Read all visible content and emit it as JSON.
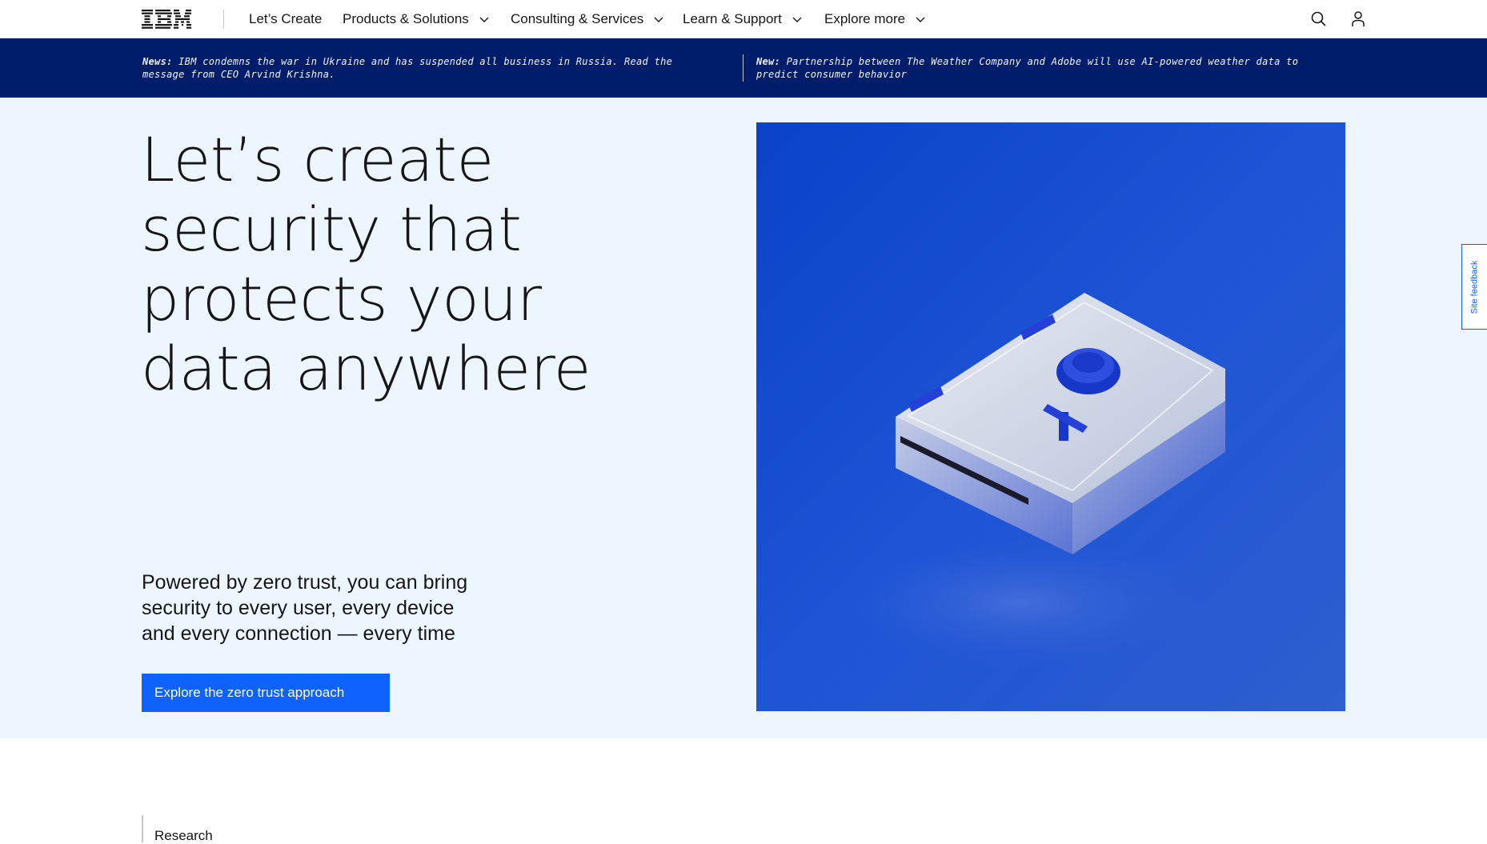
{
  "nav": {
    "logo_text": "IBM",
    "items": [
      {
        "label": "Let’s Create",
        "has_dropdown": false
      },
      {
        "label": "Products & Solutions",
        "has_dropdown": true
      },
      {
        "label": "Consulting & Services",
        "has_dropdown": true
      },
      {
        "label": "Learn & Support",
        "has_dropdown": true
      },
      {
        "label": "Explore more",
        "has_dropdown": true
      }
    ],
    "icons": [
      "search-icon",
      "user-icon"
    ]
  },
  "news": {
    "left_prefix": "News:",
    "left_text": " IBM condemns the war in Ukraine and has suspended all business in Russia. Read the message from CEO Arvind Krishna.",
    "right_prefix": "New:",
    "right_text": " Partnership between The Weather Company and Adobe will use AI-powered weather data to predict consumer behavior"
  },
  "hero": {
    "title_lines": [
      "Let’s create",
      "security that",
      "protects your",
      "data anywhere"
    ],
    "subtitle_lines": [
      "Powered by zero trust, you can bring",
      "security to every user, every device",
      "and every connection — every time"
    ],
    "cta_label": "Explore the zero trust approach"
  },
  "feedback_label": "Site feedback",
  "research_label": "Research",
  "colors": {
    "brand_blue": "#0f62fe",
    "news_bg": "#001d6c",
    "hero_bg": "#edf5ff"
  }
}
